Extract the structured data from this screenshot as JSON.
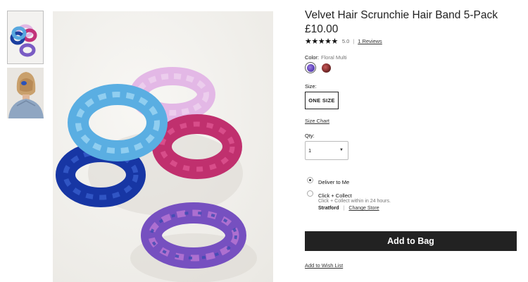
{
  "product": {
    "title": "Velvet Hair Scrunchie Hair Band 5-Pack",
    "price": "£10.00",
    "stars": "★★★★★",
    "rating": "5.0",
    "separator": "|",
    "reviews_link": "1 Reviews"
  },
  "color": {
    "label": "Color:",
    "value": "Floral Multi",
    "swatches": [
      {
        "name": "Floral Multi",
        "hex": "#6d4fc4",
        "selected": true
      },
      {
        "name": "swatch-2",
        "hex": "#7d2c2c",
        "selected": false
      }
    ]
  },
  "size": {
    "label": "Size:",
    "option": "ONE SIZE",
    "chart_link": "Size Chart"
  },
  "qty": {
    "label": "Qty:",
    "value": "1"
  },
  "delivery": {
    "options": [
      {
        "label": "Deliver to Me",
        "selected": true
      },
      {
        "label": "Click + Collect",
        "sub": "Click + Collect within in 24 hours.",
        "selected": false
      }
    ],
    "store": "Stratford",
    "separator": "|",
    "change_store": "Change Store"
  },
  "actions": {
    "add_to_bag": "Add to Bag",
    "wish_list": "Add to Wish List"
  },
  "colors": {
    "button_bg": "#222222",
    "text": "#1a1a1a"
  }
}
